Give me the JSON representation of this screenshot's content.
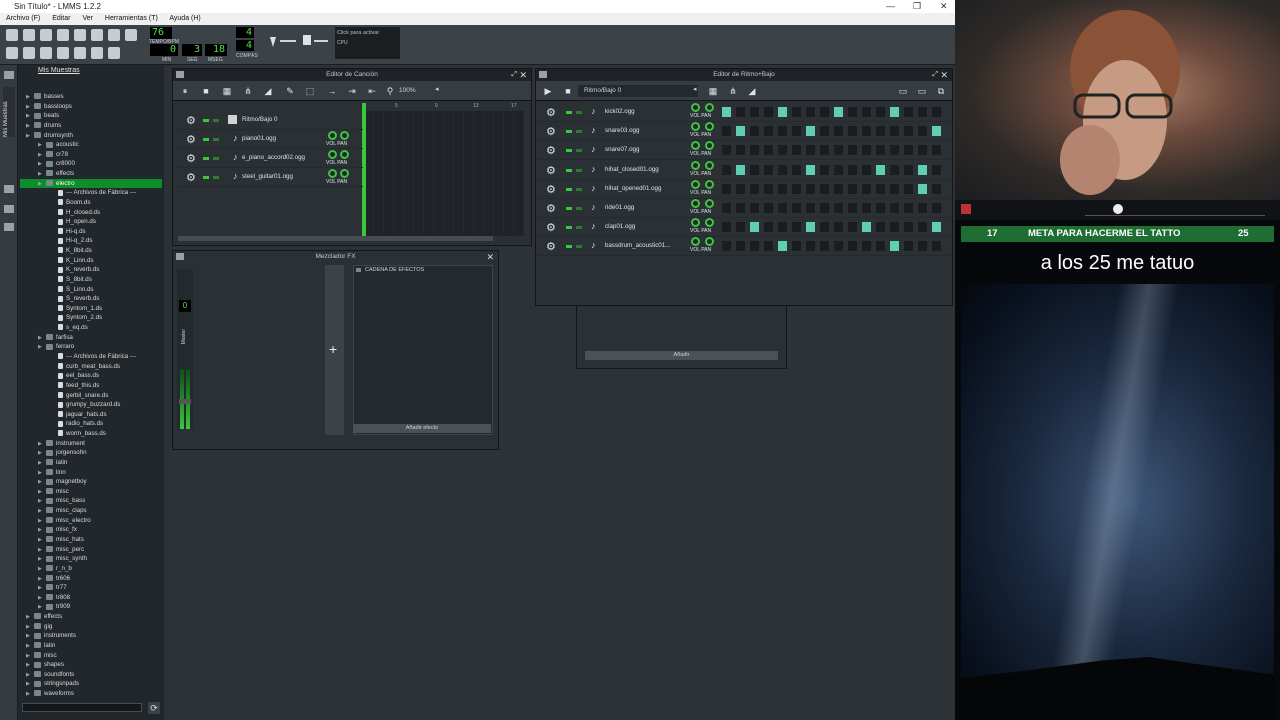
{
  "window": {
    "title": "Sin Título* - LMMS 1.2.2"
  },
  "menu": [
    "Archivo (F)",
    "Editar",
    "Ver",
    "Herramientas (T)",
    "Ayuda (H)"
  ],
  "toolbar": {
    "tempo": "76",
    "tempo_label": "TEMPO/BPM",
    "min": "0",
    "seg": "3",
    "mseg": "18",
    "min_label": "MIN",
    "seg_label": "SEG",
    "mseg_label": "MSEG",
    "time_sig_num": "4",
    "time_sig_den": "4",
    "compas_label": "COMPÁS",
    "cpu_hint": "Click para activar",
    "cpu_label": "CPU"
  },
  "sidebar": {
    "tab_label": "Mis Muestras"
  },
  "browser": {
    "title": "Mis Muestras",
    "items": [
      {
        "label": "basses",
        "depth": 0,
        "folder": true
      },
      {
        "label": "bassloops",
        "depth": 0,
        "folder": true
      },
      {
        "label": "beats",
        "depth": 0,
        "folder": true
      },
      {
        "label": "drums",
        "depth": 0,
        "folder": true
      },
      {
        "label": "drumsynth",
        "depth": 0,
        "folder": true
      },
      {
        "label": "acoustic",
        "depth": 1,
        "folder": true
      },
      {
        "label": "cr78",
        "depth": 1,
        "folder": true
      },
      {
        "label": "cr8000",
        "depth": 1,
        "folder": true
      },
      {
        "label": "effects",
        "depth": 1,
        "folder": true
      },
      {
        "label": "electro",
        "depth": 1,
        "folder": true,
        "selected": true
      },
      {
        "label": "--- Archivos de Fábrica ---",
        "depth": 2,
        "folder": false
      },
      {
        "label": "Boom.ds",
        "depth": 2,
        "folder": false
      },
      {
        "label": "H_closed.ds",
        "depth": 2,
        "folder": false
      },
      {
        "label": "H_open.ds",
        "depth": 2,
        "folder": false
      },
      {
        "label": "Hi-q.ds",
        "depth": 2,
        "folder": false
      },
      {
        "label": "Hi-q_2.ds",
        "depth": 2,
        "folder": false
      },
      {
        "label": "K_8bit.ds",
        "depth": 2,
        "folder": false
      },
      {
        "label": "K_Linn.ds",
        "depth": 2,
        "folder": false
      },
      {
        "label": "K_reverb.ds",
        "depth": 2,
        "folder": false
      },
      {
        "label": "S_8bit.ds",
        "depth": 2,
        "folder": false
      },
      {
        "label": "S_Linn.ds",
        "depth": 2,
        "folder": false
      },
      {
        "label": "S_reverb.ds",
        "depth": 2,
        "folder": false
      },
      {
        "label": "Syntom_1.ds",
        "depth": 2,
        "folder": false
      },
      {
        "label": "Syntom_2.ds",
        "depth": 2,
        "folder": false
      },
      {
        "label": "s_eq.ds",
        "depth": 2,
        "folder": false
      },
      {
        "label": "farfisa",
        "depth": 1,
        "folder": true
      },
      {
        "label": "ferraro",
        "depth": 1,
        "folder": true
      },
      {
        "label": "--- Archivos de Fábrica ---",
        "depth": 2,
        "folder": false
      },
      {
        "label": "curb_meat_bass.ds",
        "depth": 2,
        "folder": false
      },
      {
        "label": "eel_bass.ds",
        "depth": 2,
        "folder": false
      },
      {
        "label": "feed_this.ds",
        "depth": 2,
        "folder": false
      },
      {
        "label": "gerbil_snare.ds",
        "depth": 2,
        "folder": false
      },
      {
        "label": "grumpy_buzzard.ds",
        "depth": 2,
        "folder": false
      },
      {
        "label": "jaguar_hats.ds",
        "depth": 2,
        "folder": false
      },
      {
        "label": "radio_hats.ds",
        "depth": 2,
        "folder": false
      },
      {
        "label": "worm_bass.ds",
        "depth": 2,
        "folder": false
      },
      {
        "label": "instrument",
        "depth": 1,
        "folder": true
      },
      {
        "label": "jorgensohn",
        "depth": 1,
        "folder": true
      },
      {
        "label": "latin",
        "depth": 1,
        "folder": true
      },
      {
        "label": "linn",
        "depth": 1,
        "folder": true
      },
      {
        "label": "magnetboy",
        "depth": 1,
        "folder": true
      },
      {
        "label": "misc",
        "depth": 1,
        "folder": true
      },
      {
        "label": "misc_bass",
        "depth": 1,
        "folder": true
      },
      {
        "label": "misc_claps",
        "depth": 1,
        "folder": true
      },
      {
        "label": "misc_electro",
        "depth": 1,
        "folder": true
      },
      {
        "label": "misc_fx",
        "depth": 1,
        "folder": true
      },
      {
        "label": "misc_hats",
        "depth": 1,
        "folder": true
      },
      {
        "label": "misc_perc",
        "depth": 1,
        "folder": true
      },
      {
        "label": "misc_synth",
        "depth": 1,
        "folder": true
      },
      {
        "label": "r_n_b",
        "depth": 1,
        "folder": true
      },
      {
        "label": "tr606",
        "depth": 1,
        "folder": true
      },
      {
        "label": "tr77",
        "depth": 1,
        "folder": true
      },
      {
        "label": "tr808",
        "depth": 1,
        "folder": true
      },
      {
        "label": "tr909",
        "depth": 1,
        "folder": true
      },
      {
        "label": "effects",
        "depth": 0,
        "folder": true
      },
      {
        "label": "gig",
        "depth": 0,
        "folder": true
      },
      {
        "label": "instruments",
        "depth": 0,
        "folder": true
      },
      {
        "label": "latin",
        "depth": 0,
        "folder": true
      },
      {
        "label": "misc",
        "depth": 0,
        "folder": true
      },
      {
        "label": "shapes",
        "depth": 0,
        "folder": true
      },
      {
        "label": "soundfonts",
        "depth": 0,
        "folder": true
      },
      {
        "label": "stringsnpads",
        "depth": 0,
        "folder": true
      },
      {
        "label": "waveforms",
        "depth": 0,
        "folder": true
      }
    ]
  },
  "song_editor": {
    "title": "Editor de Canción",
    "zoom": "100%",
    "ruler": [
      "5",
      "9",
      "13",
      "17"
    ],
    "vol_pan": "VOL PAN",
    "tracks": [
      {
        "name": "Ritmo/Bajo 0"
      },
      {
        "name": "piano01.ogg"
      },
      {
        "name": "e_piano_accord02.ogg"
      },
      {
        "name": "steel_guitar01.ogg"
      }
    ]
  },
  "beat_editor": {
    "title": "Editor de Ritmo+Bajo",
    "pattern": "Ritmo/Bajo 0",
    "vol_pan": "VOL PAN",
    "tracks": [
      {
        "name": "kick02.ogg",
        "steps": [
          1,
          0,
          0,
          0,
          1,
          0,
          0,
          0,
          1,
          0,
          0,
          0,
          1,
          0,
          0,
          0
        ]
      },
      {
        "name": "snare03.ogg",
        "steps": [
          0,
          1,
          0,
          0,
          0,
          0,
          1,
          0,
          0,
          0,
          0,
          0,
          0,
          0,
          0,
          1
        ]
      },
      {
        "name": "snare07.ogg",
        "steps": [
          0,
          0,
          0,
          0,
          0,
          0,
          0,
          0,
          0,
          0,
          0,
          0,
          0,
          0,
          0,
          0
        ]
      },
      {
        "name": "hihat_closed01.ogg",
        "steps": [
          0,
          1,
          0,
          0,
          0,
          0,
          1,
          0,
          0,
          0,
          0,
          1,
          0,
          0,
          1,
          0
        ]
      },
      {
        "name": "hihat_opened01.ogg",
        "steps": [
          0,
          0,
          0,
          0,
          0,
          0,
          0,
          0,
          0,
          0,
          0,
          0,
          0,
          0,
          1,
          0
        ]
      },
      {
        "name": "ride01.ogg",
        "steps": [
          0,
          0,
          0,
          0,
          0,
          0,
          0,
          0,
          0,
          0,
          0,
          0,
          0,
          0,
          0,
          0
        ]
      },
      {
        "name": "clap01.ogg",
        "steps": [
          0,
          0,
          1,
          0,
          0,
          0,
          1,
          0,
          0,
          0,
          1,
          0,
          0,
          0,
          0,
          1
        ]
      },
      {
        "name": "bassdrum_acoustic01...",
        "steps": [
          0,
          0,
          0,
          0,
          1,
          0,
          0,
          0,
          0,
          0,
          0,
          0,
          1,
          0,
          0,
          0
        ]
      }
    ]
  },
  "mixer": {
    "title": "Mezclador FX",
    "master_label": "Master",
    "master_value": "0",
    "fx_chain_label": "CADENA DE EFECTOS",
    "add_effect": "Añadir efecto"
  },
  "ghost": {
    "add_label": "Añadir"
  },
  "stream": {
    "goal_left": "17",
    "goal_text": "META PARA HACERME EL TATTO",
    "goal_right": "25",
    "caption": "a los 25 me tatuo"
  },
  "colors": {
    "accent": "#0d8e2b",
    "step_on": "#5fcfb0",
    "goal_bg": "#1e6d33"
  }
}
